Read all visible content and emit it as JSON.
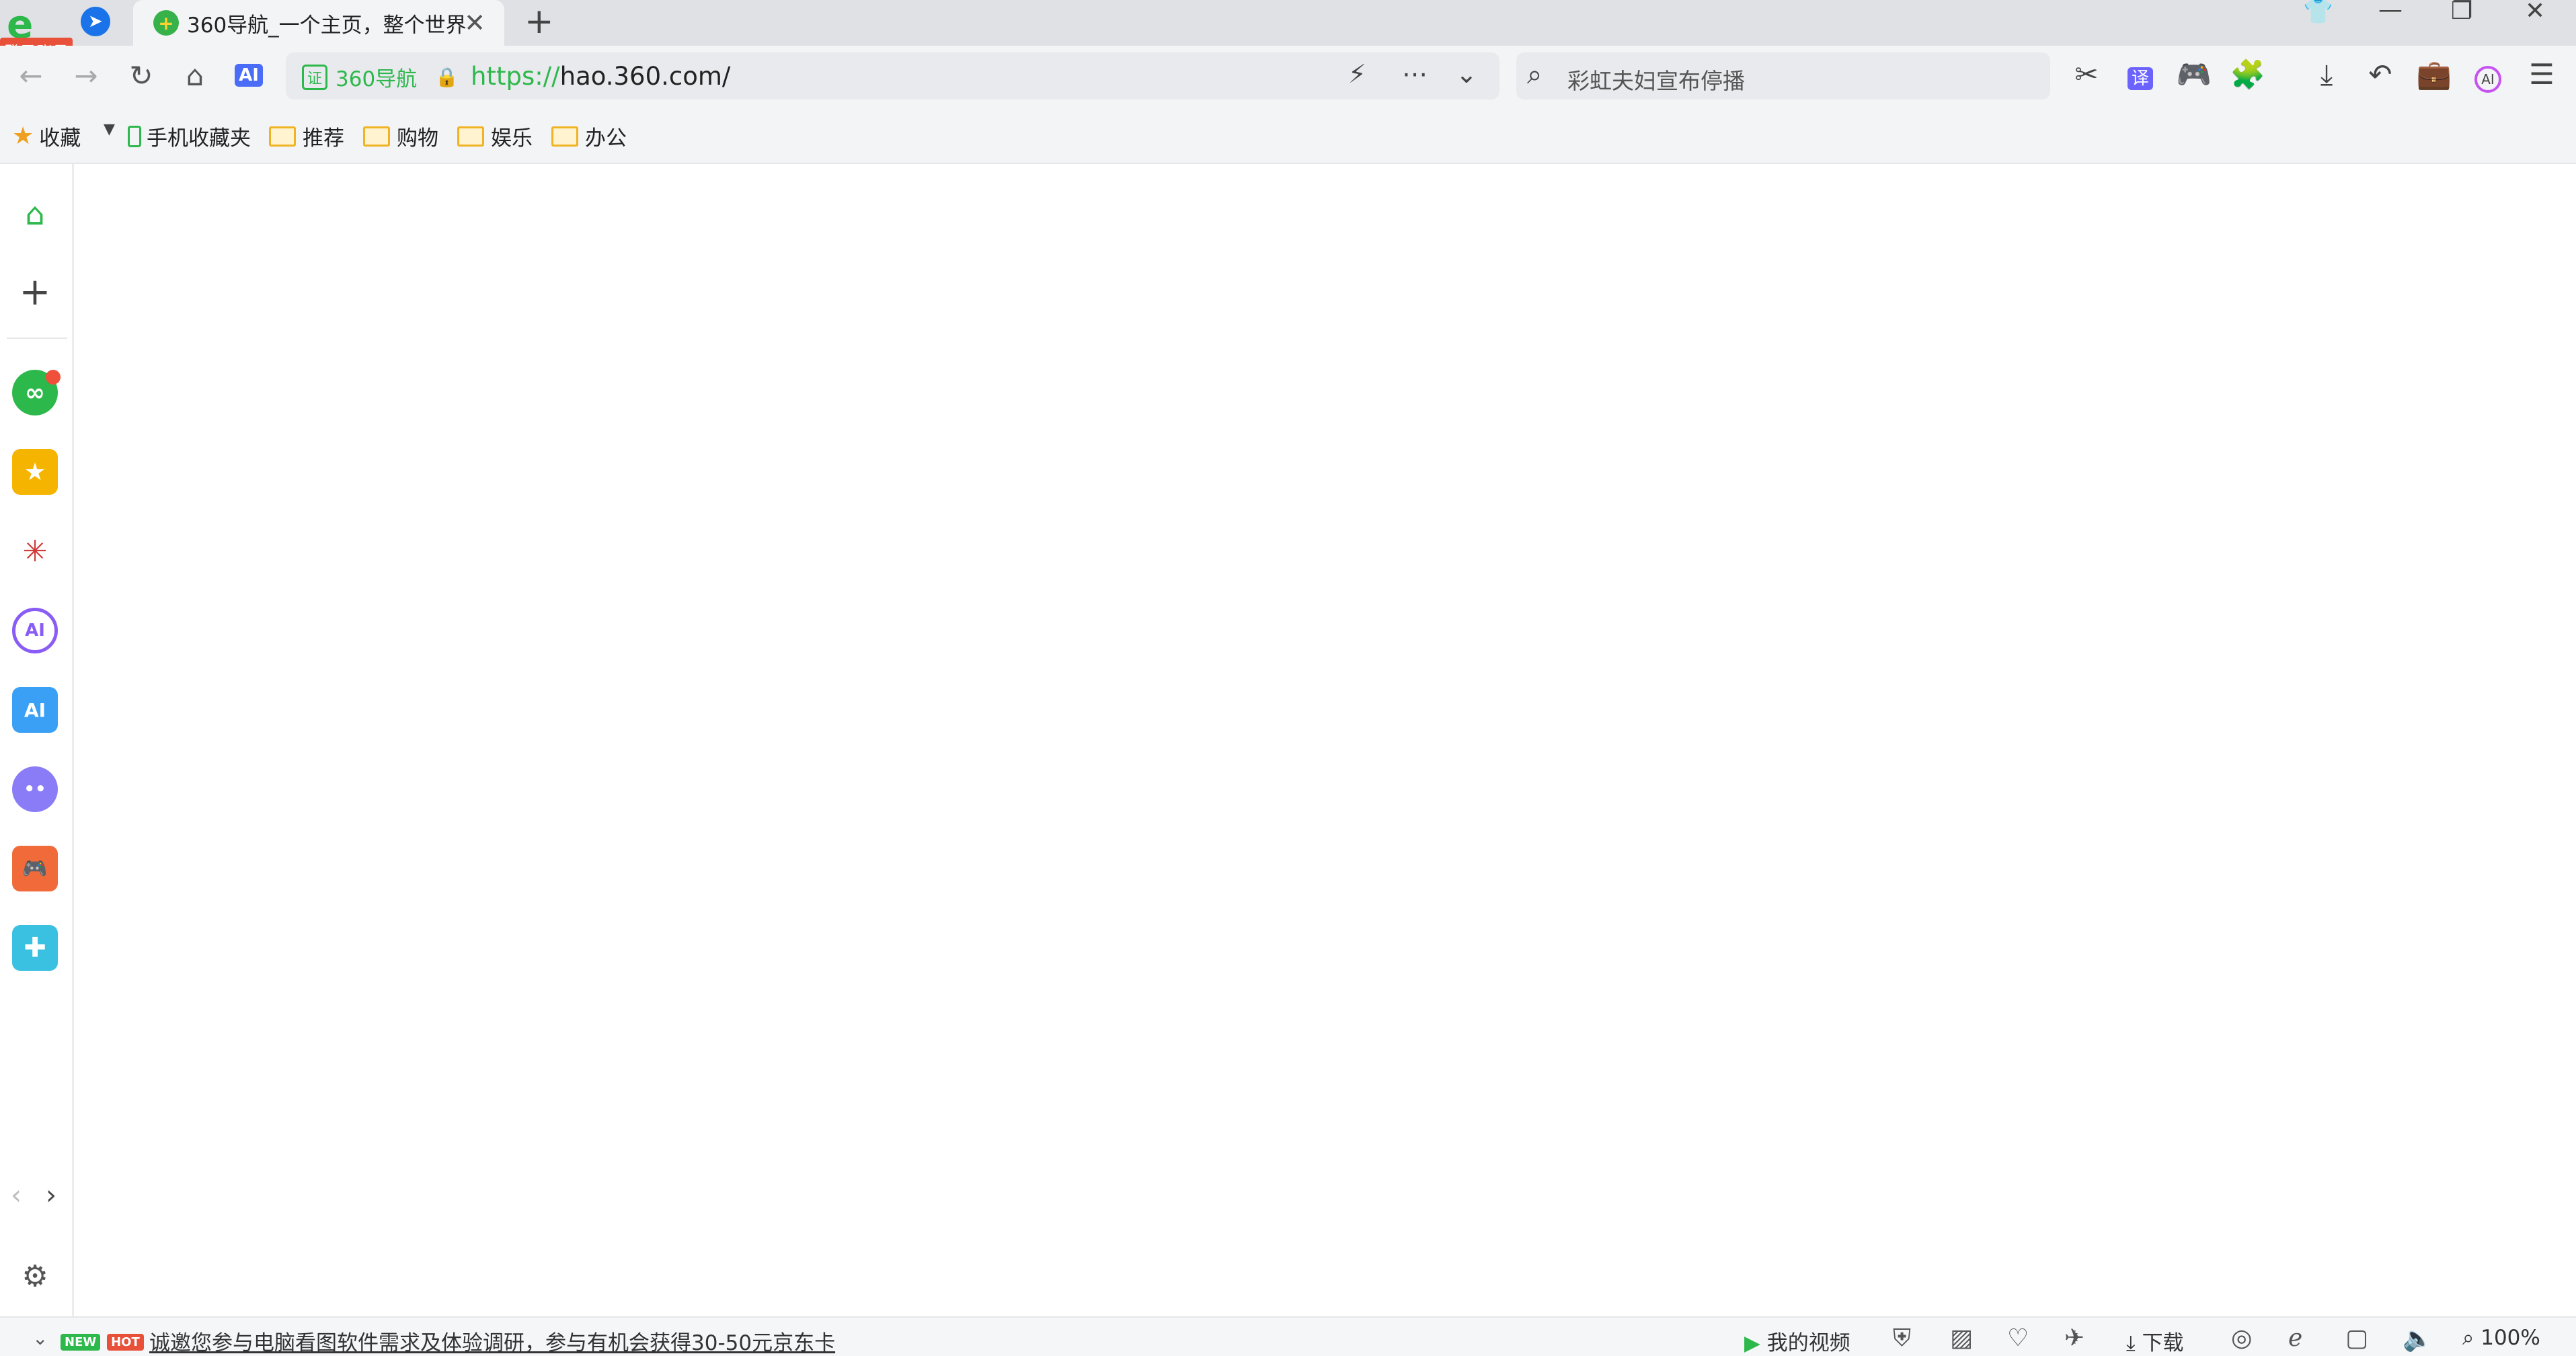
{
  "login_badge": "登录账号",
  "tab": {
    "title": "360导航_一个主页，整个世界",
    "close": "✕"
  },
  "newtab": "+",
  "window": {
    "skin": "👕",
    "minimize": "—",
    "restore": "❐",
    "close": "✕"
  },
  "address": {
    "cert_label": "360导航",
    "url_protocol": "https://",
    "url_rest": "hao.360.com/"
  },
  "search": {
    "text": "彩虹夫妇宣布停播"
  },
  "bookmarks": [
    {
      "label": "收藏"
    },
    {
      "label": "手机收藏夹"
    },
    {
      "label": "推荐"
    },
    {
      "label": "购物"
    },
    {
      "label": "娱乐"
    },
    {
      "label": "办公"
    }
  ],
  "status": {
    "tag_new": "NEW",
    "tag_hot": "HOT",
    "promo": "诚邀您参与电脑看图软件需求及体验调研，参与有机会获得30-50元京东卡",
    "my_video": "我的视频",
    "download": "下载",
    "zoom": "100%"
  },
  "icons": {
    "back": "back-icon",
    "forward": "forward-icon",
    "refresh": "refresh-icon",
    "home": "home-icon",
    "ai": "ai-icon"
  },
  "colors": {
    "accent_green": "#2db84b",
    "hot_red": "#e8503a",
    "new_green": "#2db84b"
  }
}
